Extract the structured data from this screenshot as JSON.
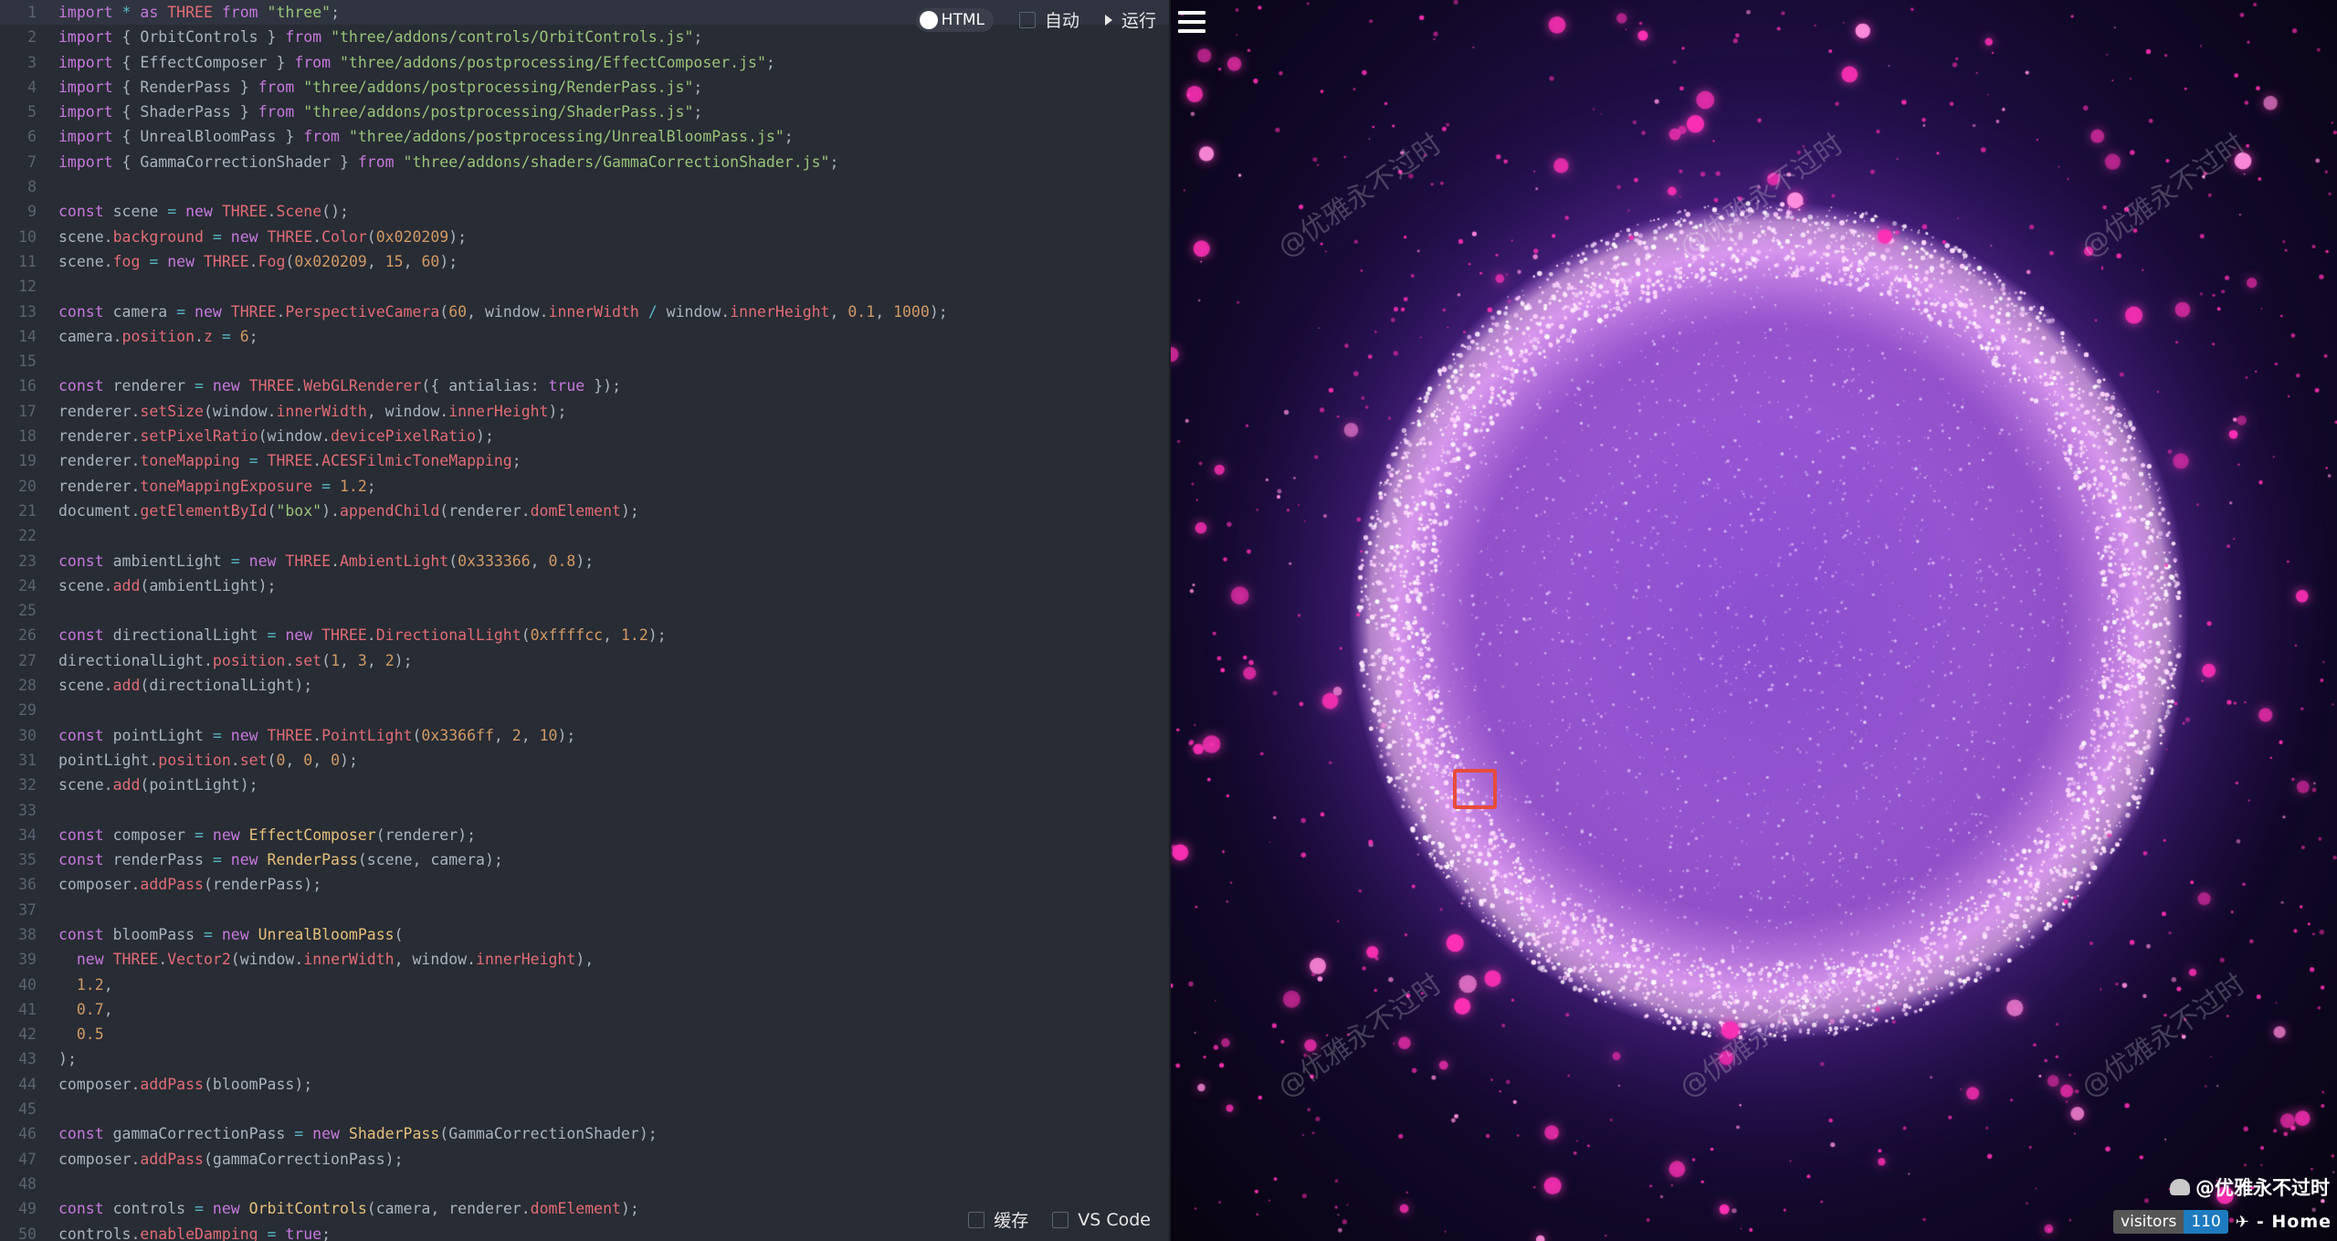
{
  "editor": {
    "toolbar": {
      "html_toggle": "HTML",
      "auto_label": "自动",
      "run_label": "运行"
    },
    "bottom": {
      "cache_label": "缓存",
      "vscode_label": "VS Code"
    },
    "lines": [
      {
        "n": "1",
        "t": "import * as THREE from \"three\";"
      },
      {
        "n": "2",
        "t": "import { OrbitControls } from \"three/addons/controls/OrbitControls.js\";"
      },
      {
        "n": "3",
        "t": "import { EffectComposer } from \"three/addons/postprocessing/EffectComposer.js\";"
      },
      {
        "n": "4",
        "t": "import { RenderPass } from \"three/addons/postprocessing/RenderPass.js\";"
      },
      {
        "n": "5",
        "t": "import { ShaderPass } from \"three/addons/postprocessing/ShaderPass.js\";"
      },
      {
        "n": "6",
        "t": "import { UnrealBloomPass } from \"three/addons/postprocessing/UnrealBloomPass.js\";"
      },
      {
        "n": "7",
        "t": "import { GammaCorrectionShader } from \"three/addons/shaders/GammaCorrectionShader.js\";"
      },
      {
        "n": "8",
        "t": ""
      },
      {
        "n": "9",
        "t": "const scene = new THREE.Scene();"
      },
      {
        "n": "10",
        "t": "scene.background = new THREE.Color(0x020209);"
      },
      {
        "n": "11",
        "t": "scene.fog = new THREE.Fog(0x020209, 15, 60);"
      },
      {
        "n": "12",
        "t": ""
      },
      {
        "n": "13",
        "t": "const camera = new THREE.PerspectiveCamera(60, window.innerWidth / window.innerHeight, 0.1, 1000);"
      },
      {
        "n": "14",
        "t": "camera.position.z = 6;"
      },
      {
        "n": "15",
        "t": ""
      },
      {
        "n": "16",
        "t": "const renderer = new THREE.WebGLRenderer({ antialias: true });"
      },
      {
        "n": "17",
        "t": "renderer.setSize(window.innerWidth, window.innerHeight);"
      },
      {
        "n": "18",
        "t": "renderer.setPixelRatio(window.devicePixelRatio);"
      },
      {
        "n": "19",
        "t": "renderer.toneMapping = THREE.ACESFilmicToneMapping;"
      },
      {
        "n": "20",
        "t": "renderer.toneMappingExposure = 1.2;"
      },
      {
        "n": "21",
        "t": "document.getElementById(\"box\").appendChild(renderer.domElement);"
      },
      {
        "n": "22",
        "t": ""
      },
      {
        "n": "23",
        "t": "const ambientLight = new THREE.AmbientLight(0x333366, 0.8);"
      },
      {
        "n": "24",
        "t": "scene.add(ambientLight);"
      },
      {
        "n": "25",
        "t": ""
      },
      {
        "n": "26",
        "t": "const directionalLight = new THREE.DirectionalLight(0xffffcc, 1.2);"
      },
      {
        "n": "27",
        "t": "directionalLight.position.set(1, 3, 2);"
      },
      {
        "n": "28",
        "t": "scene.add(directionalLight);"
      },
      {
        "n": "29",
        "t": ""
      },
      {
        "n": "30",
        "t": "const pointLight = new THREE.PointLight(0x3366ff, 2, 10);"
      },
      {
        "n": "31",
        "t": "pointLight.position.set(0, 0, 0);"
      },
      {
        "n": "32",
        "t": "scene.add(pointLight);"
      },
      {
        "n": "33",
        "t": ""
      },
      {
        "n": "34",
        "t": "const composer = new EffectComposer(renderer);"
      },
      {
        "n": "35",
        "t": "const renderPass = new RenderPass(scene, camera);"
      },
      {
        "n": "36",
        "t": "composer.addPass(renderPass);"
      },
      {
        "n": "37",
        "t": ""
      },
      {
        "n": "38",
        "t": "const bloomPass = new UnrealBloomPass("
      },
      {
        "n": "39",
        "t": "  new THREE.Vector2(window.innerWidth, window.innerHeight),"
      },
      {
        "n": "40",
        "t": "  1.2,"
      },
      {
        "n": "41",
        "t": "  0.7,"
      },
      {
        "n": "42",
        "t": "  0.5"
      },
      {
        "n": "43",
        "t": ");"
      },
      {
        "n": "44",
        "t": "composer.addPass(bloomPass);"
      },
      {
        "n": "45",
        "t": ""
      },
      {
        "n": "46",
        "t": "const gammaCorrectionPass = new ShaderPass(GammaCorrectionShader);"
      },
      {
        "n": "47",
        "t": "composer.addPass(gammaCorrectionPass);"
      },
      {
        "n": "48",
        "t": ""
      },
      {
        "n": "49",
        "t": "const controls = new OrbitControls(camera, renderer.domElement);"
      },
      {
        "n": "50",
        "t": "controls.enableDamping = true;"
      }
    ]
  },
  "preview": {
    "watermark": "@优雅永不过时",
    "brand_text": "@优雅永不过时",
    "visitors_label": "visitors",
    "visitors_count": "110",
    "home_label": "- Home",
    "colors": {
      "background": "#07040f",
      "glow": "#d27cff",
      "particle": "#ff2fb5",
      "highlight": "#e74c3c"
    }
  }
}
